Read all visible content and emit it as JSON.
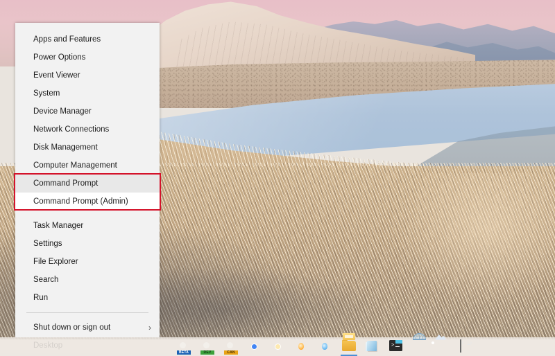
{
  "desktop": {
    "wallpaper_description": "Sunset dune landscape with pink sky, pale sand ridge, blue water band and dense dry grass foreground",
    "colors": {
      "sky": "#e8bfc8",
      "dune": "#efe2d8",
      "water": "#aec3da",
      "grass": "#c8ae88",
      "mountain": "#8d9ab0"
    }
  },
  "start_menu": {
    "name": "Win+X Quick Link Menu",
    "background": "#f2f2f2",
    "groups": [
      {
        "items": [
          {
            "label": "Apps and Features",
            "state": "normal"
          },
          {
            "label": "Power Options",
            "state": "normal"
          },
          {
            "label": "Event Viewer",
            "state": "normal"
          },
          {
            "label": "System",
            "state": "normal"
          },
          {
            "label": "Device Manager",
            "state": "normal"
          },
          {
            "label": "Network Connections",
            "state": "normal"
          },
          {
            "label": "Disk Management",
            "state": "normal"
          },
          {
            "label": "Computer Management",
            "state": "normal"
          },
          {
            "label": "Command Prompt",
            "state": "hovered"
          },
          {
            "label": "Command Prompt (Admin)",
            "state": "highlighted"
          },
          {
            "label": "Task Manager",
            "state": "normal"
          },
          {
            "label": "Settings",
            "state": "normal"
          },
          {
            "label": "File Explorer",
            "state": "normal"
          },
          {
            "label": "Search",
            "state": "normal"
          },
          {
            "label": "Run",
            "state": "normal"
          }
        ]
      },
      {
        "items": [
          {
            "label": "Shut down or sign out",
            "state": "normal",
            "submenu_arrow": "›"
          },
          {
            "label": "Desktop",
            "state": "normal"
          }
        ]
      }
    ]
  },
  "annotation": {
    "type": "rectangle-highlight",
    "color": "#d4122a",
    "targets": [
      "Command Prompt",
      "Command Prompt (Admin)"
    ]
  },
  "taskbar": {
    "background": "#eee8e2",
    "items": [
      {
        "icon": "edge-beta-icon",
        "label": "Microsoft Edge Beta",
        "badge": "BETA",
        "active": false
      },
      {
        "icon": "edge-dev-icon",
        "label": "Microsoft Edge Dev",
        "badge": "DEV",
        "active": false
      },
      {
        "icon": "edge-canary-icon",
        "label": "Microsoft Edge Canary",
        "badge": "CAN",
        "active": false
      },
      {
        "icon": "chrome-icon",
        "label": "Google Chrome",
        "badge": "",
        "active": false
      },
      {
        "icon": "chrome-canary-icon",
        "label": "Google Chrome Canary",
        "badge": "",
        "active": false
      },
      {
        "icon": "firefox-icon",
        "label": "Mozilla Firefox",
        "badge": "",
        "active": false
      },
      {
        "icon": "firefox-developer-icon",
        "label": "Firefox Developer Edition",
        "badge": "",
        "active": false
      },
      {
        "icon": "file-explorer-icon",
        "label": "File Explorer",
        "badge": "",
        "active": true
      },
      {
        "icon": "notebook-icon",
        "label": "OneNote",
        "badge": "",
        "active": false
      },
      {
        "icon": "windows-terminal-icon",
        "label": "Windows Terminal",
        "badge": "",
        "active": false
      },
      {
        "icon": "protractor-icon",
        "label": "Design Tool",
        "badge": "",
        "active": false
      },
      {
        "icon": "photos-icon",
        "label": "Photos",
        "badge": "",
        "active": false
      },
      {
        "icon": "command-prompt-icon",
        "label": "Command Prompt",
        "badge": "",
        "active": false
      }
    ]
  }
}
